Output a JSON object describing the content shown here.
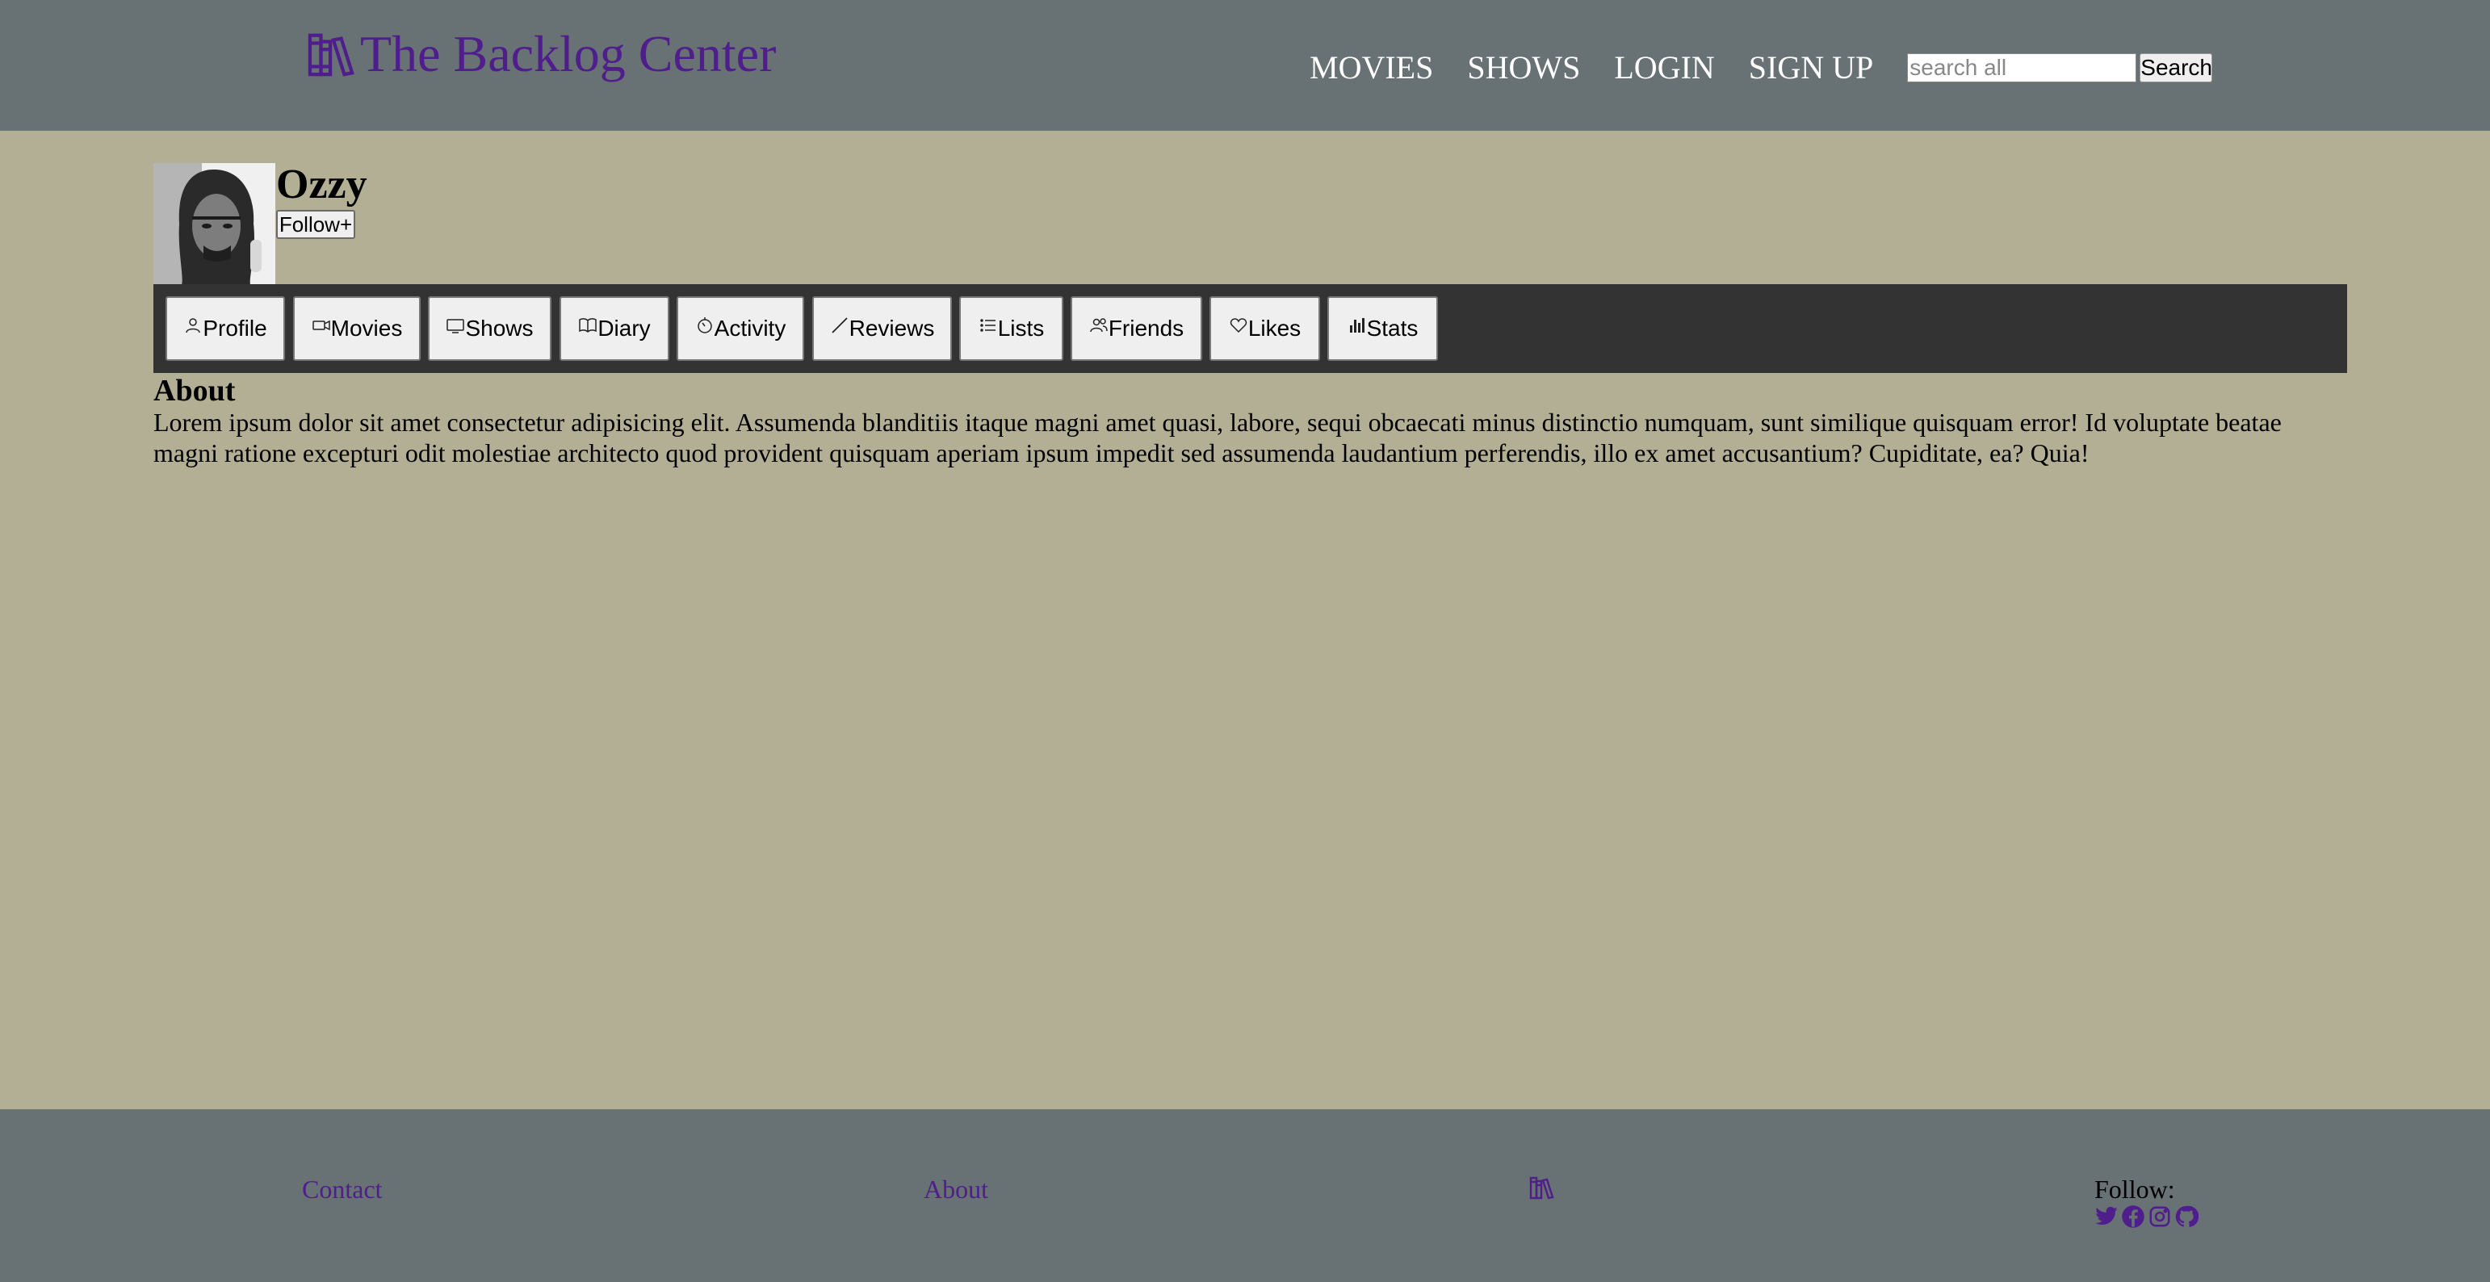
{
  "brand": {
    "title": "The Backlog Center",
    "icon": "books-icon",
    "color": "#4f1e8c"
  },
  "nav": {
    "items": [
      "MOVIES",
      "SHOWS",
      "LOGIN",
      "SIGN UP"
    ],
    "search_placeholder": "search all",
    "search_button": "Search"
  },
  "profile": {
    "username": "Ozzy",
    "follow_label": "Follow+",
    "avatar": "avatar-photo"
  },
  "tabs": [
    {
      "label": "Profile",
      "icon": "user-icon"
    },
    {
      "label": "Movies",
      "icon": "video-camera-icon"
    },
    {
      "label": "Shows",
      "icon": "tv-icon"
    },
    {
      "label": "Diary",
      "icon": "open-book-icon"
    },
    {
      "label": "Activity",
      "icon": "timer-icon"
    },
    {
      "label": "Reviews",
      "icon": "pen-line-icon"
    },
    {
      "label": "Lists",
      "icon": "list-icon"
    },
    {
      "label": "Friends",
      "icon": "users-icon"
    },
    {
      "label": "Likes",
      "icon": "heart-icon"
    },
    {
      "label": "Stats",
      "icon": "bar-chart-icon"
    }
  ],
  "about": {
    "heading": "About",
    "text": "Lorem ipsum dolor sit amet consectetur adipisicing elit. Assumenda blanditiis itaque magni amet quasi, labore, sequi obcaecati minus distinctio numquam, sunt similique quisquam error! Id voluptate beatae magni ratione excepturi odit molestiae architecto quod provident quisquam aperiam ipsum impedit sed assumenda laudantium perferendis, illo ex amet accusantium? Cupiditate, ea? Quia!"
  },
  "footer": {
    "contact": "Contact",
    "about": "About",
    "follow_label": "Follow:",
    "social": [
      "twitter-icon",
      "facebook-icon",
      "instagram-icon",
      "github-icon"
    ]
  },
  "colors": {
    "header_bg": "#687174",
    "page_bg": "#b2af94",
    "tabbar_bg": "#333333",
    "accent": "#4f1e8c"
  }
}
